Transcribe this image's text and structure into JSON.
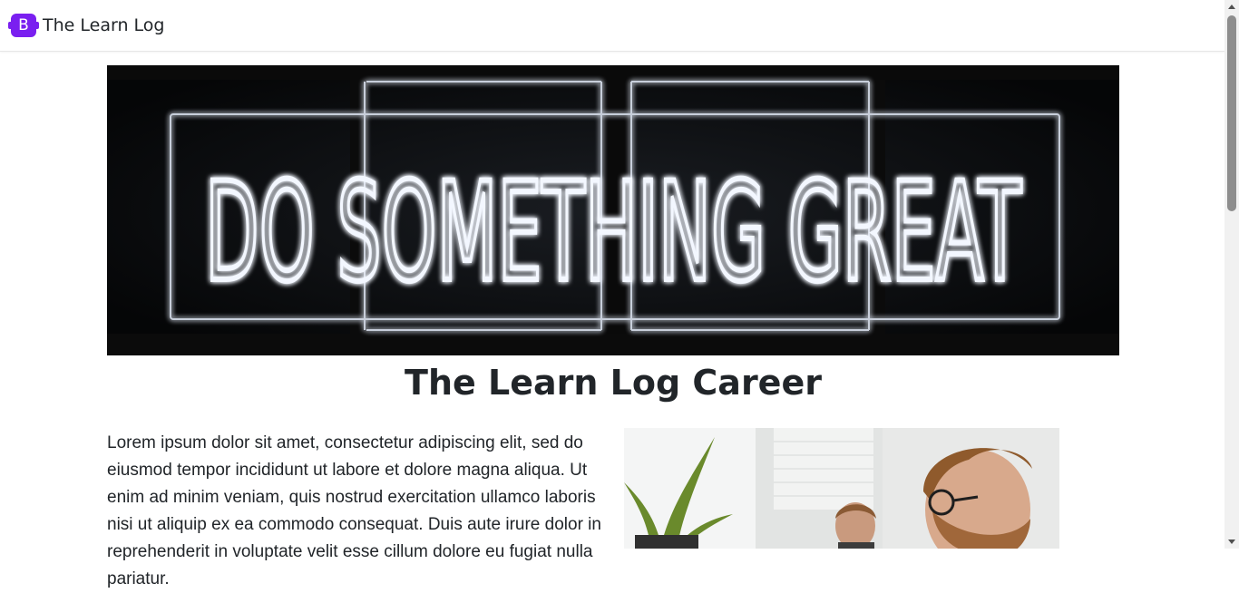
{
  "navbar": {
    "logo_letter": "B",
    "brand_name": "The Learn Log"
  },
  "hero": {
    "alt": "Neon sign reading DO SOMETHING GREAT",
    "sign_text": "DO SOMETHING GREAT"
  },
  "main": {
    "title": "The Learn Log Career",
    "paragraph": "Lorem ipsum dolor sit amet, consectetur adipiscing elit, sed do eiusmod tempor incididunt ut labore et dolore magna aliqua. Ut enim ad minim veniam, quis nostrud exercitation ullamco laboris nisi ut aliquip ex ea commodo consequat. Duis aute irure dolor in reprehenderit in voluptate velit esse cillum dolore eu fugiat nulla pariatur.",
    "photo_alt": "Office photo of a man with glasses at a desk"
  },
  "colors": {
    "brand": "#7a1ff0",
    "text": "#212529",
    "neon": "#eef4ff"
  }
}
